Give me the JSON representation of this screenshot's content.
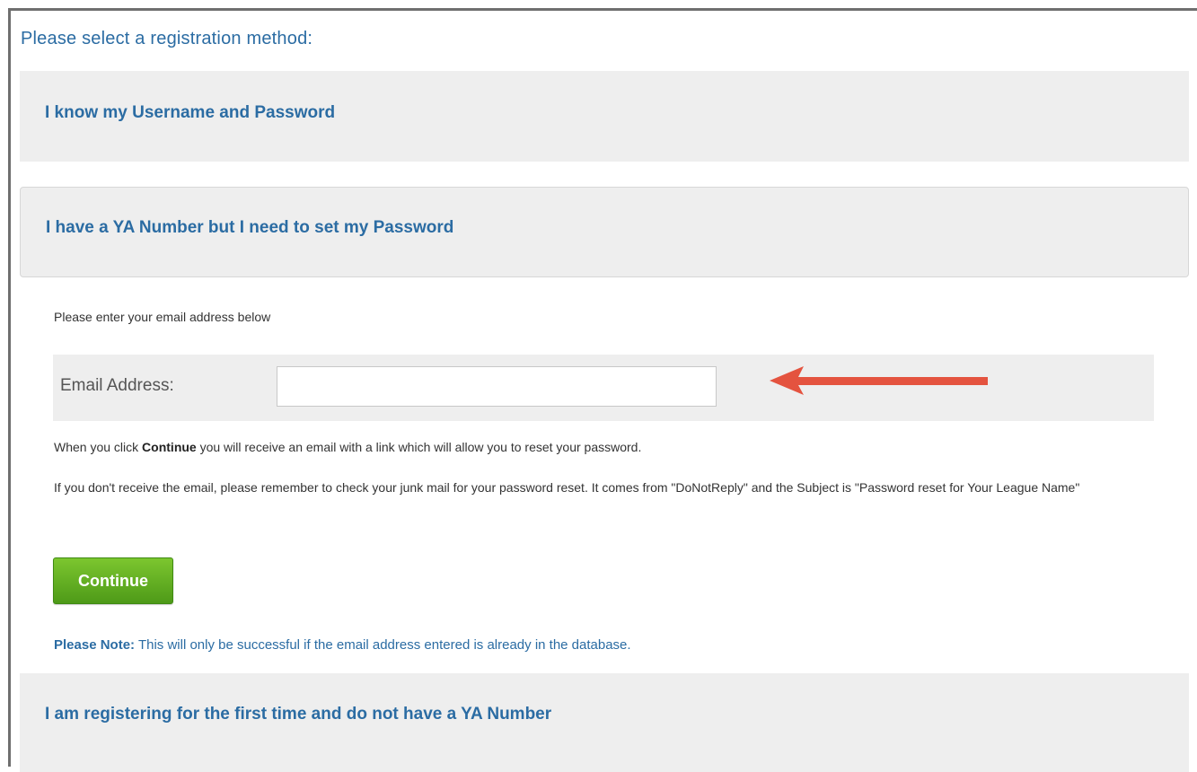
{
  "page": {
    "title": "Please select a registration method:"
  },
  "panels": {
    "username_password": "I know my Username and Password",
    "ya_number": "I have a YA Number but I need to set my Password",
    "first_time": "I am registering for the first time and do not have a YA Number"
  },
  "form": {
    "instruction": "Please enter your email address below",
    "email_label": "Email Address:",
    "email_value": "",
    "email_placeholder": ""
  },
  "info": {
    "line1_prefix": "When you click ",
    "line1_bold": "Continue",
    "line1_suffix": " you will receive an email with a link which will allow you to reset your password.",
    "line2": "If you don't receive the email, please remember to check your junk mail for your password reset. It comes from \"DoNotReply\" and the Subject is \"Password reset for Your League Name\""
  },
  "actions": {
    "continue_label": "Continue"
  },
  "note": {
    "label": "Please Note:",
    "text": " This will only be successful if the email address entered is already in the database."
  },
  "annotation": {
    "arrow_color": "#e4533f"
  },
  "colors": {
    "link_blue": "#2b6ca3",
    "button_green": "#5aa820",
    "panel_gray": "#eeeeee"
  }
}
